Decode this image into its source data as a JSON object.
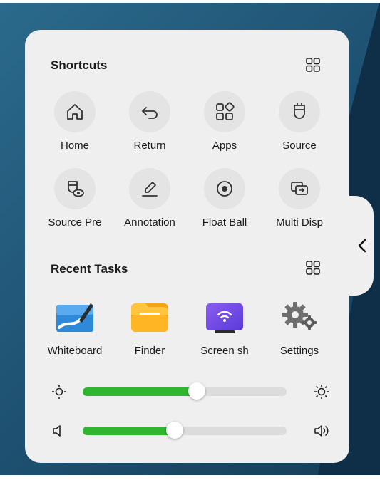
{
  "shortcuts": {
    "title": "Shortcuts",
    "items": [
      {
        "label": "Home",
        "icon": "home-icon"
      },
      {
        "label": "Return",
        "icon": "return-icon"
      },
      {
        "label": "Apps",
        "icon": "apps-icon"
      },
      {
        "label": "Source",
        "icon": "source-icon"
      },
      {
        "label": "Source Pre",
        "icon": "source-preview-icon"
      },
      {
        "label": "Annotation",
        "icon": "annotation-icon"
      },
      {
        "label": "Float Ball",
        "icon": "float-ball-icon"
      },
      {
        "label": "Multi Disp",
        "icon": "multi-display-icon"
      }
    ]
  },
  "recent_tasks": {
    "title": "Recent Tasks",
    "items": [
      {
        "label": "Whiteboard",
        "icon": "whiteboard-app-icon"
      },
      {
        "label": "Finder",
        "icon": "finder-app-icon"
      },
      {
        "label": "Screen sh",
        "icon": "screen-share-app-icon"
      },
      {
        "label": "Settings",
        "icon": "settings-app-icon"
      }
    ]
  },
  "sliders": {
    "brightness": {
      "value": 0.56,
      "icon_low": "brightness-low-icon",
      "icon_high": "brightness-high-icon"
    },
    "volume": {
      "value": 0.45,
      "icon_low": "volume-low-icon",
      "icon_high": "volume-high-icon"
    }
  },
  "colors": {
    "panel": "#efefef",
    "slider_fill": "#2fb52f",
    "slider_track": "#dcdcdc"
  }
}
